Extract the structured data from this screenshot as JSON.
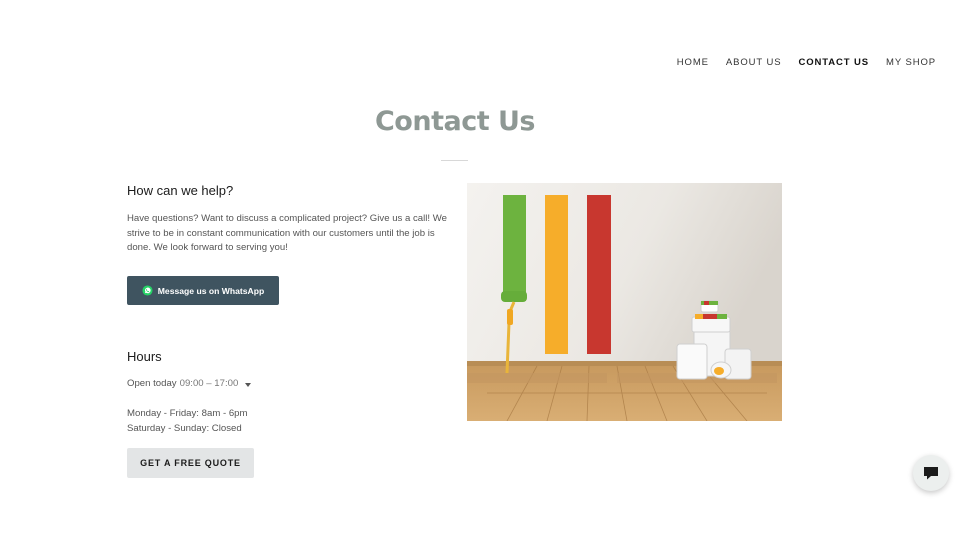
{
  "nav": {
    "items": [
      {
        "label": "HOME"
      },
      {
        "label": "ABOUT US"
      },
      {
        "label": "CONTACT US"
      },
      {
        "label": "MY SHOP"
      }
    ],
    "active": "CONTACT US"
  },
  "page": {
    "title": "Contact Us"
  },
  "contact": {
    "heading": "How can we help?",
    "body": "Have questions? Want to discuss a complicated project? Give us a call! We strive to be in constant communication with our customers until the job is done. We look forward to serving you!",
    "whatsapp_label": "Message us on WhatsApp"
  },
  "hours": {
    "heading": "Hours",
    "open_label": "Open today",
    "open_time": "09:00 – 17:00",
    "weekday": "Monday - Friday: 8am - 6pm",
    "weekend": "Saturday - Sunday: Closed"
  },
  "cta": {
    "quote_label": "GET A FREE QUOTE"
  },
  "colors": {
    "whatsapp_button": "#3f5460",
    "quote_button": "#e3e5e6",
    "title": "#8e9894",
    "stripe_green": "#6db33f",
    "stripe_orange": "#f6ad2a",
    "stripe_red": "#c8372f"
  },
  "icons": {
    "whatsapp": "whatsapp-icon",
    "chat": "chat-bubble-icon",
    "caret": "caret-down-icon"
  }
}
